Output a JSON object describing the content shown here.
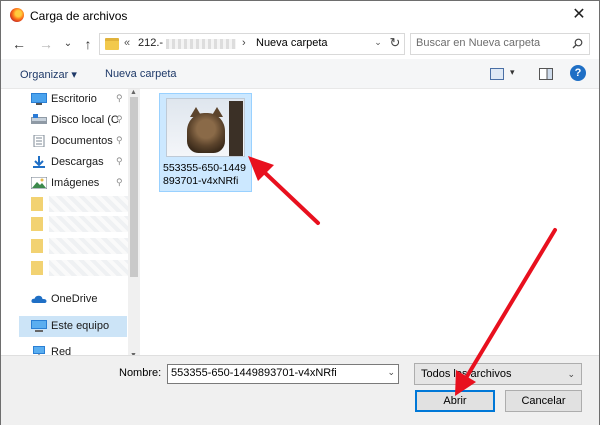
{
  "window": {
    "title": "Carga de archivos",
    "close_symbol": "✕",
    "app_icon": "firefox-icon"
  },
  "nav": {
    "back_symbol": "←",
    "forward_symbol": "→",
    "recent_symbol": "⌄",
    "up_symbol": "↑"
  },
  "address": {
    "chevron": "«",
    "segment1": "212.-",
    "separator": "›",
    "segment2": "Nueva carpeta",
    "dropdown_symbol": "⌄",
    "refresh_symbol": "↻"
  },
  "search": {
    "placeholder": "Buscar en Nueva carpeta"
  },
  "toolbar": {
    "organize_label": "Organizar ▾",
    "new_folder_label": "Nueva carpeta",
    "help_symbol": "?",
    "view_dropdown_symbol": "▾"
  },
  "sidebar": {
    "items": [
      {
        "label": "Escritorio",
        "icon": "desktop-icon",
        "pinned": true
      },
      {
        "label": "Disco local (C",
        "icon": "drive-icon",
        "pinned": true
      },
      {
        "label": "Documentos",
        "icon": "documents-icon",
        "pinned": true
      },
      {
        "label": "Descargas",
        "icon": "downloads-icon",
        "pinned": true
      },
      {
        "label": "Imágenes",
        "icon": "pictures-icon",
        "pinned": true
      },
      {
        "label": "OneDrive",
        "icon": "onedrive-icon",
        "pinned": false
      },
      {
        "label": "Este equipo",
        "icon": "computer-icon",
        "pinned": false
      },
      {
        "label": "Red",
        "icon": "network-icon",
        "pinned": false
      }
    ],
    "pin_symbol": "📌"
  },
  "files": [
    {
      "name": "553355-650-1449893701-v4xNRfi",
      "selected": true
    }
  ],
  "footer": {
    "name_label": "Nombre:",
    "name_value": "553355-650-1449893701-v4xNRfi",
    "filter_value": "Todos los archivos",
    "dropdown_symbol": "⌄",
    "open_label": "Abrir",
    "cancel_label": "Cancelar"
  },
  "colors": {
    "annotation_arrow": "#e8101e",
    "selection": "#cce8ff",
    "accent": "#0078d7"
  }
}
